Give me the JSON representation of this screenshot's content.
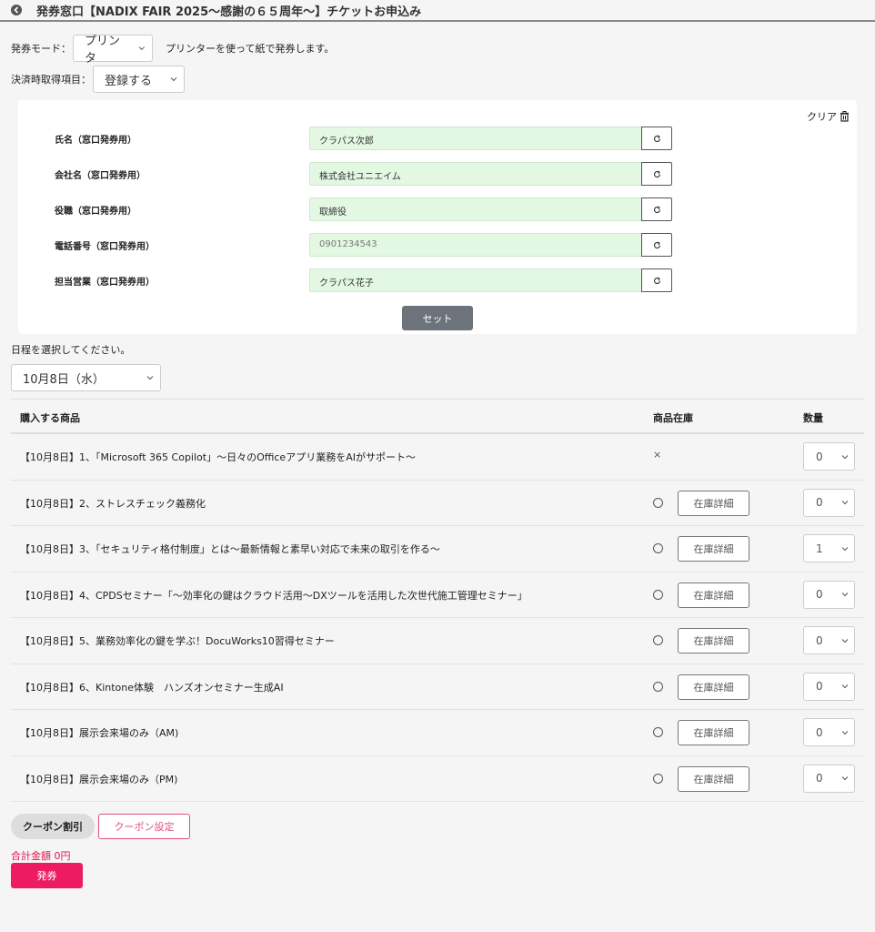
{
  "header": {
    "title": "発券窓口【NADIX FAIR 2025～感謝の６５周年～】チケットお申込み"
  },
  "mode": {
    "label": "発券モード：",
    "value": "プリンタ",
    "note": "プリンターを使って紙で発券します。"
  },
  "payment": {
    "label": "決済時取得項目：",
    "value": "登録する"
  },
  "form": {
    "clear_label": "クリア",
    "fields": [
      {
        "label": "氏名（窓口発券用）",
        "value": "クラパス次郎"
      },
      {
        "label": "会社名（窓口発券用）",
        "value": "株式会社ユニエイム"
      },
      {
        "label": "役職（窓口発券用）",
        "value": "取締役"
      },
      {
        "label": "電話番号（窓口発券用）",
        "value": "0901234543"
      },
      {
        "label": "担当営業（窓口発券用）",
        "value": "クラパス花子"
      }
    ],
    "set_label": "セット"
  },
  "schedule": {
    "label": "日程を選択してください。",
    "value": "10月8日（水）"
  },
  "table": {
    "headers": {
      "product": "購入する商品",
      "stock": "商品在庫",
      "qty": "数量"
    },
    "detail_label": "在庫詳細",
    "rows": [
      {
        "name": "【10月8日】1、「Microsoft 365 Copilot」～日々のOfficeアプリ業務をAIがサポート～",
        "stock": "×",
        "qty": "0"
      },
      {
        "name": "【10月8日】2、ストレスチェック義務化",
        "stock": "○",
        "qty": "0"
      },
      {
        "name": "【10月8日】3、「セキュリティ格付制度」とは～最新情報と素早い対応で未来の取引を作る～",
        "stock": "○",
        "qty": "1"
      },
      {
        "name": "【10月8日】4、CPDSセミナー「～効率化の鍵はクラウド活用～DXツールを活用した次世代施工管理セミナー」",
        "stock": "○",
        "qty": "0"
      },
      {
        "name": "【10月8日】5、業務効率化の鍵を学ぶ！DocuWorks10習得セミナー",
        "stock": "○",
        "qty": "0"
      },
      {
        "name": "【10月8日】6、Kintone体験　ハンズオンセミナー生成AI",
        "stock": "○",
        "qty": "0"
      },
      {
        "name": "【10月8日】展示会来場のみ（AM)",
        "stock": "○",
        "qty": "0"
      },
      {
        "name": "【10月8日】展示会来場のみ（PM)",
        "stock": "○",
        "qty": "0"
      }
    ]
  },
  "coupon": {
    "tag": "クーポン割引",
    "button": "クーポン設定"
  },
  "total": "合計金額 0円",
  "issue_label": "発券",
  "colors": {
    "accent": "#ed1b62",
    "input_bg": "#e3f8e3",
    "set_button": "#6d737a"
  }
}
